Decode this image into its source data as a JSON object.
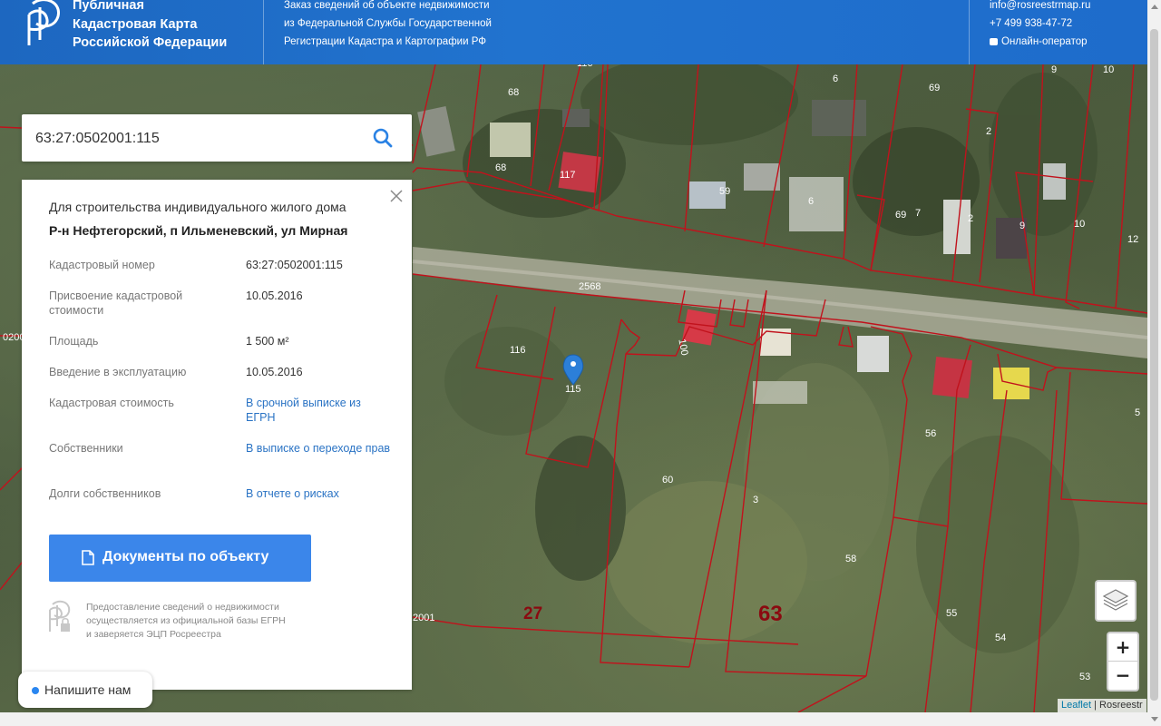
{
  "header": {
    "title_lines": [
      "Публичная",
      "Кадастровая Карта",
      "Российской Федерации"
    ],
    "info_lines": [
      "Заказ сведений об объекте недвижимости",
      "из Федеральной Службы Государственной",
      "Регистрации Кадастра и Картографии РФ"
    ],
    "email": "info@rosreestrmap.ru",
    "phone": "+7 499 938-47-72",
    "operator": "Онлайн-оператор"
  },
  "search": {
    "value": "63:27:0502001:115"
  },
  "panel": {
    "purpose": "Для строительства индивидуального жилого дома",
    "address": "Р-н Нефтегорский, п Ильменевский, ул Мирная",
    "rows": [
      {
        "label": "Кадастровый номер",
        "value": "63:27:0502001:115"
      },
      {
        "label": "Присвоение кадастровой стоимости",
        "value": "10.05.2016"
      },
      {
        "label": "Площадь",
        "value": "1 500 м²"
      },
      {
        "label": "Введение в эксплуатацию",
        "value": "10.05.2016"
      },
      {
        "label": "Кадастровая стоимость",
        "value": "В срочной выписке из ЕГРН"
      },
      {
        "label": "Собственники",
        "value": "В выписке о переходе прав"
      },
      {
        "label": "Долги собственников",
        "value": "В отчете о рисках"
      }
    ],
    "docs_button": "Документы по объекту",
    "note_lines": [
      "Предоставление сведений о недвижимости",
      "осуществляется из официальной базы ЕГРН",
      "и заверяется ЭЦП Росреестра"
    ]
  },
  "chat": {
    "label": "Напишите нам"
  },
  "attribution": {
    "leaflet": "Leaflet",
    "separator": " | ",
    "source": "Rosreestr"
  },
  "map": {
    "parcel_labels": [
      "68",
      "68",
      "117",
      "116",
      "59",
      "6",
      "6",
      "69",
      "69",
      "7",
      "2",
      "2",
      "9",
      "9",
      "10",
      "10",
      "12",
      "2568",
      "100",
      "116",
      "115",
      "60",
      "3",
      "56",
      "58",
      "55",
      "54",
      "53",
      "116"
    ],
    "district_labels": [
      "27",
      "63"
    ],
    "edge_labels": [
      "0200",
      "2001"
    ]
  }
}
